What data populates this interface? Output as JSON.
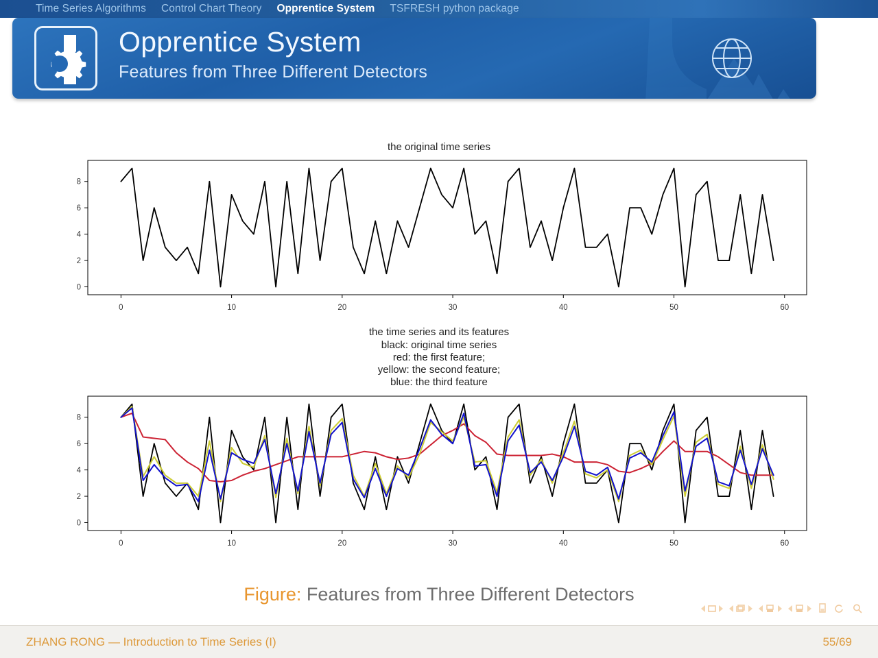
{
  "nav": {
    "items": [
      {
        "label": "Time Series Algorithms",
        "active": false
      },
      {
        "label": "Control Chart Theory",
        "active": false
      },
      {
        "label": "Opprentice System",
        "active": true
      },
      {
        "label": "TSFRESH python package",
        "active": false
      }
    ]
  },
  "header": {
    "title": "Opprentice System",
    "subtitle": "Features from Three Different Detectors",
    "logo_icon": "kde-gear-k-logo",
    "globe_icon": "globe-icon",
    "bg_color": "#1f5fa8",
    "text_color": "#f2f8ff"
  },
  "caption": {
    "label": "Figure:",
    "text": "Features from Three Different Detectors",
    "label_color": "#e8962f",
    "text_color": "#6d6d6d"
  },
  "footer": {
    "left": "ZHANG RONG — Introduction to Time Series (I)",
    "right": "55/69",
    "color": "#dd9a3c"
  },
  "nav_symbols": {
    "groups": [
      "slide-prev-next",
      "frame-prev-next",
      "subsection-prev-next",
      "section-prev-next",
      "doc-home",
      "back-search"
    ]
  },
  "chart_data": [
    {
      "type": "line",
      "title": "the original time series",
      "xlabel": "",
      "ylabel": "",
      "xlim": [
        -3,
        62
      ],
      "ylim": [
        -0.6,
        9.6
      ],
      "xticks": [
        0,
        10,
        20,
        30,
        40,
        50,
        60
      ],
      "yticks": [
        0,
        2,
        4,
        6,
        8
      ],
      "grid": false,
      "legend_position": "none",
      "x": [
        0,
        1,
        2,
        3,
        4,
        5,
        6,
        7,
        8,
        9,
        10,
        11,
        12,
        13,
        14,
        15,
        16,
        17,
        18,
        19,
        20,
        21,
        22,
        23,
        24,
        25,
        26,
        27,
        28,
        29,
        30,
        31,
        32,
        33,
        34,
        35,
        36,
        37,
        38,
        39,
        40,
        41,
        42,
        43,
        44,
        45,
        46,
        47,
        48,
        49,
        50,
        51,
        52,
        53,
        54,
        55,
        56,
        57,
        58,
        59
      ],
      "series": [
        {
          "name": "original time series",
          "color": "#000000",
          "values": [
            8,
            9,
            2,
            6,
            3,
            2,
            3,
            1,
            8,
            0,
            7,
            5,
            4,
            8,
            0,
            8,
            1,
            9,
            2,
            8,
            9,
            3,
            1,
            5,
            1,
            5,
            3,
            6,
            9,
            7,
            6,
            9,
            4,
            5,
            1,
            8,
            9,
            3,
            5,
            2,
            6,
            9,
            3,
            3,
            4,
            0,
            6,
            6,
            4,
            7,
            9,
            0,
            7,
            8,
            2,
            2,
            7,
            1,
            7,
            2
          ]
        }
      ]
    },
    {
      "type": "line",
      "title": "the time series and its features\nblack: original time series\nred: the first feature;\nyellow: the second feature;\nblue: the third feature",
      "xlabel": "",
      "ylabel": "",
      "xlim": [
        -3,
        62
      ],
      "ylim": [
        -0.6,
        9.6
      ],
      "xticks": [
        0,
        10,
        20,
        30,
        40,
        50,
        60
      ],
      "yticks": [
        0,
        2,
        4,
        6,
        8
      ],
      "grid": false,
      "legend_position": "in-title",
      "x": [
        0,
        1,
        2,
        3,
        4,
        5,
        6,
        7,
        8,
        9,
        10,
        11,
        12,
        13,
        14,
        15,
        16,
        17,
        18,
        19,
        20,
        21,
        22,
        23,
        24,
        25,
        26,
        27,
        28,
        29,
        30,
        31,
        32,
        33,
        34,
        35,
        36,
        37,
        38,
        39,
        40,
        41,
        42,
        43,
        44,
        45,
        46,
        47,
        48,
        49,
        50,
        51,
        52,
        53,
        54,
        55,
        56,
        57,
        58,
        59
      ],
      "series": [
        {
          "name": "black: original time series",
          "color": "#000000",
          "values": [
            8,
            9,
            2,
            6,
            3,
            2,
            3,
            1,
            8,
            0,
            7,
            5,
            4,
            8,
            0,
            8,
            1,
            9,
            2,
            8,
            9,
            3,
            1,
            5,
            1,
            5,
            3,
            6,
            9,
            7,
            6,
            9,
            4,
            5,
            1,
            8,
            9,
            3,
            5,
            2,
            6,
            9,
            3,
            3,
            4,
            0,
            6,
            6,
            4,
            7,
            9,
            0,
            7,
            8,
            2,
            2,
            7,
            1,
            7,
            2
          ]
        },
        {
          "name": "red: the first feature",
          "color": "#cc2233",
          "values": [
            8.0,
            8.3,
            6.5,
            6.4,
            6.3,
            5.3,
            4.6,
            4.1,
            3.2,
            3.1,
            3.2,
            3.6,
            3.9,
            4.1,
            4.4,
            4.7,
            5.0,
            5.0,
            5.0,
            5.0,
            5.0,
            5.2,
            5.4,
            5.3,
            5.0,
            4.8,
            4.9,
            5.2,
            5.9,
            6.6,
            7.0,
            7.5,
            6.6,
            6.1,
            5.2,
            5.1,
            5.1,
            5.1,
            5.1,
            5.2,
            5.0,
            4.6,
            4.6,
            4.6,
            4.4,
            3.9,
            3.8,
            4.1,
            4.5,
            5.4,
            6.2,
            5.4,
            5.4,
            5.4,
            5.0,
            4.4,
            3.8,
            3.6,
            3.6,
            3.6
          ]
        },
        {
          "name": "yellow: the second feature",
          "color": "#cccc33",
          "values": [
            8.0,
            8.8,
            3.5,
            5.0,
            3.6,
            3.0,
            3.0,
            2.0,
            6.2,
            1.6,
            5.7,
            4.5,
            4.2,
            6.6,
            1.9,
            6.4,
            2.2,
            7.3,
            2.8,
            7.0,
            7.9,
            3.6,
            2.0,
            4.5,
            2.2,
            4.3,
            3.4,
            5.2,
            7.6,
            6.9,
            6.2,
            8.0,
            4.6,
            4.7,
            2.3,
            6.5,
            7.8,
            3.6,
            4.8,
            3.0,
            5.3,
            7.7,
            3.7,
            3.4,
            4.0,
            1.6,
            5.1,
            5.5,
            4.4,
            6.3,
            8.1,
            2.0,
            6.1,
            6.7,
            2.9,
            2.6,
            5.8,
            2.6,
            5.9,
            3.3
          ]
        },
        {
          "name": "blue: the third feature",
          "color": "#1111cc",
          "values": [
            8.0,
            8.7,
            3.2,
            4.4,
            3.4,
            2.8,
            2.9,
            1.6,
            5.5,
            1.8,
            5.3,
            4.8,
            4.5,
            6.3,
            2.2,
            6.0,
            2.4,
            6.9,
            3.0,
            6.7,
            7.6,
            3.3,
            1.9,
            4.1,
            2.0,
            4.1,
            3.6,
            5.6,
            7.8,
            6.7,
            6.0,
            8.3,
            4.3,
            4.4,
            2.0,
            6.2,
            7.4,
            3.8,
            4.6,
            3.2,
            5.0,
            7.3,
            3.9,
            3.6,
            4.2,
            1.8,
            4.9,
            5.3,
            4.6,
            6.6,
            8.4,
            2.4,
            5.8,
            6.4,
            3.1,
            2.8,
            5.5,
            2.9,
            5.6,
            3.6
          ]
        }
      ]
    }
  ]
}
